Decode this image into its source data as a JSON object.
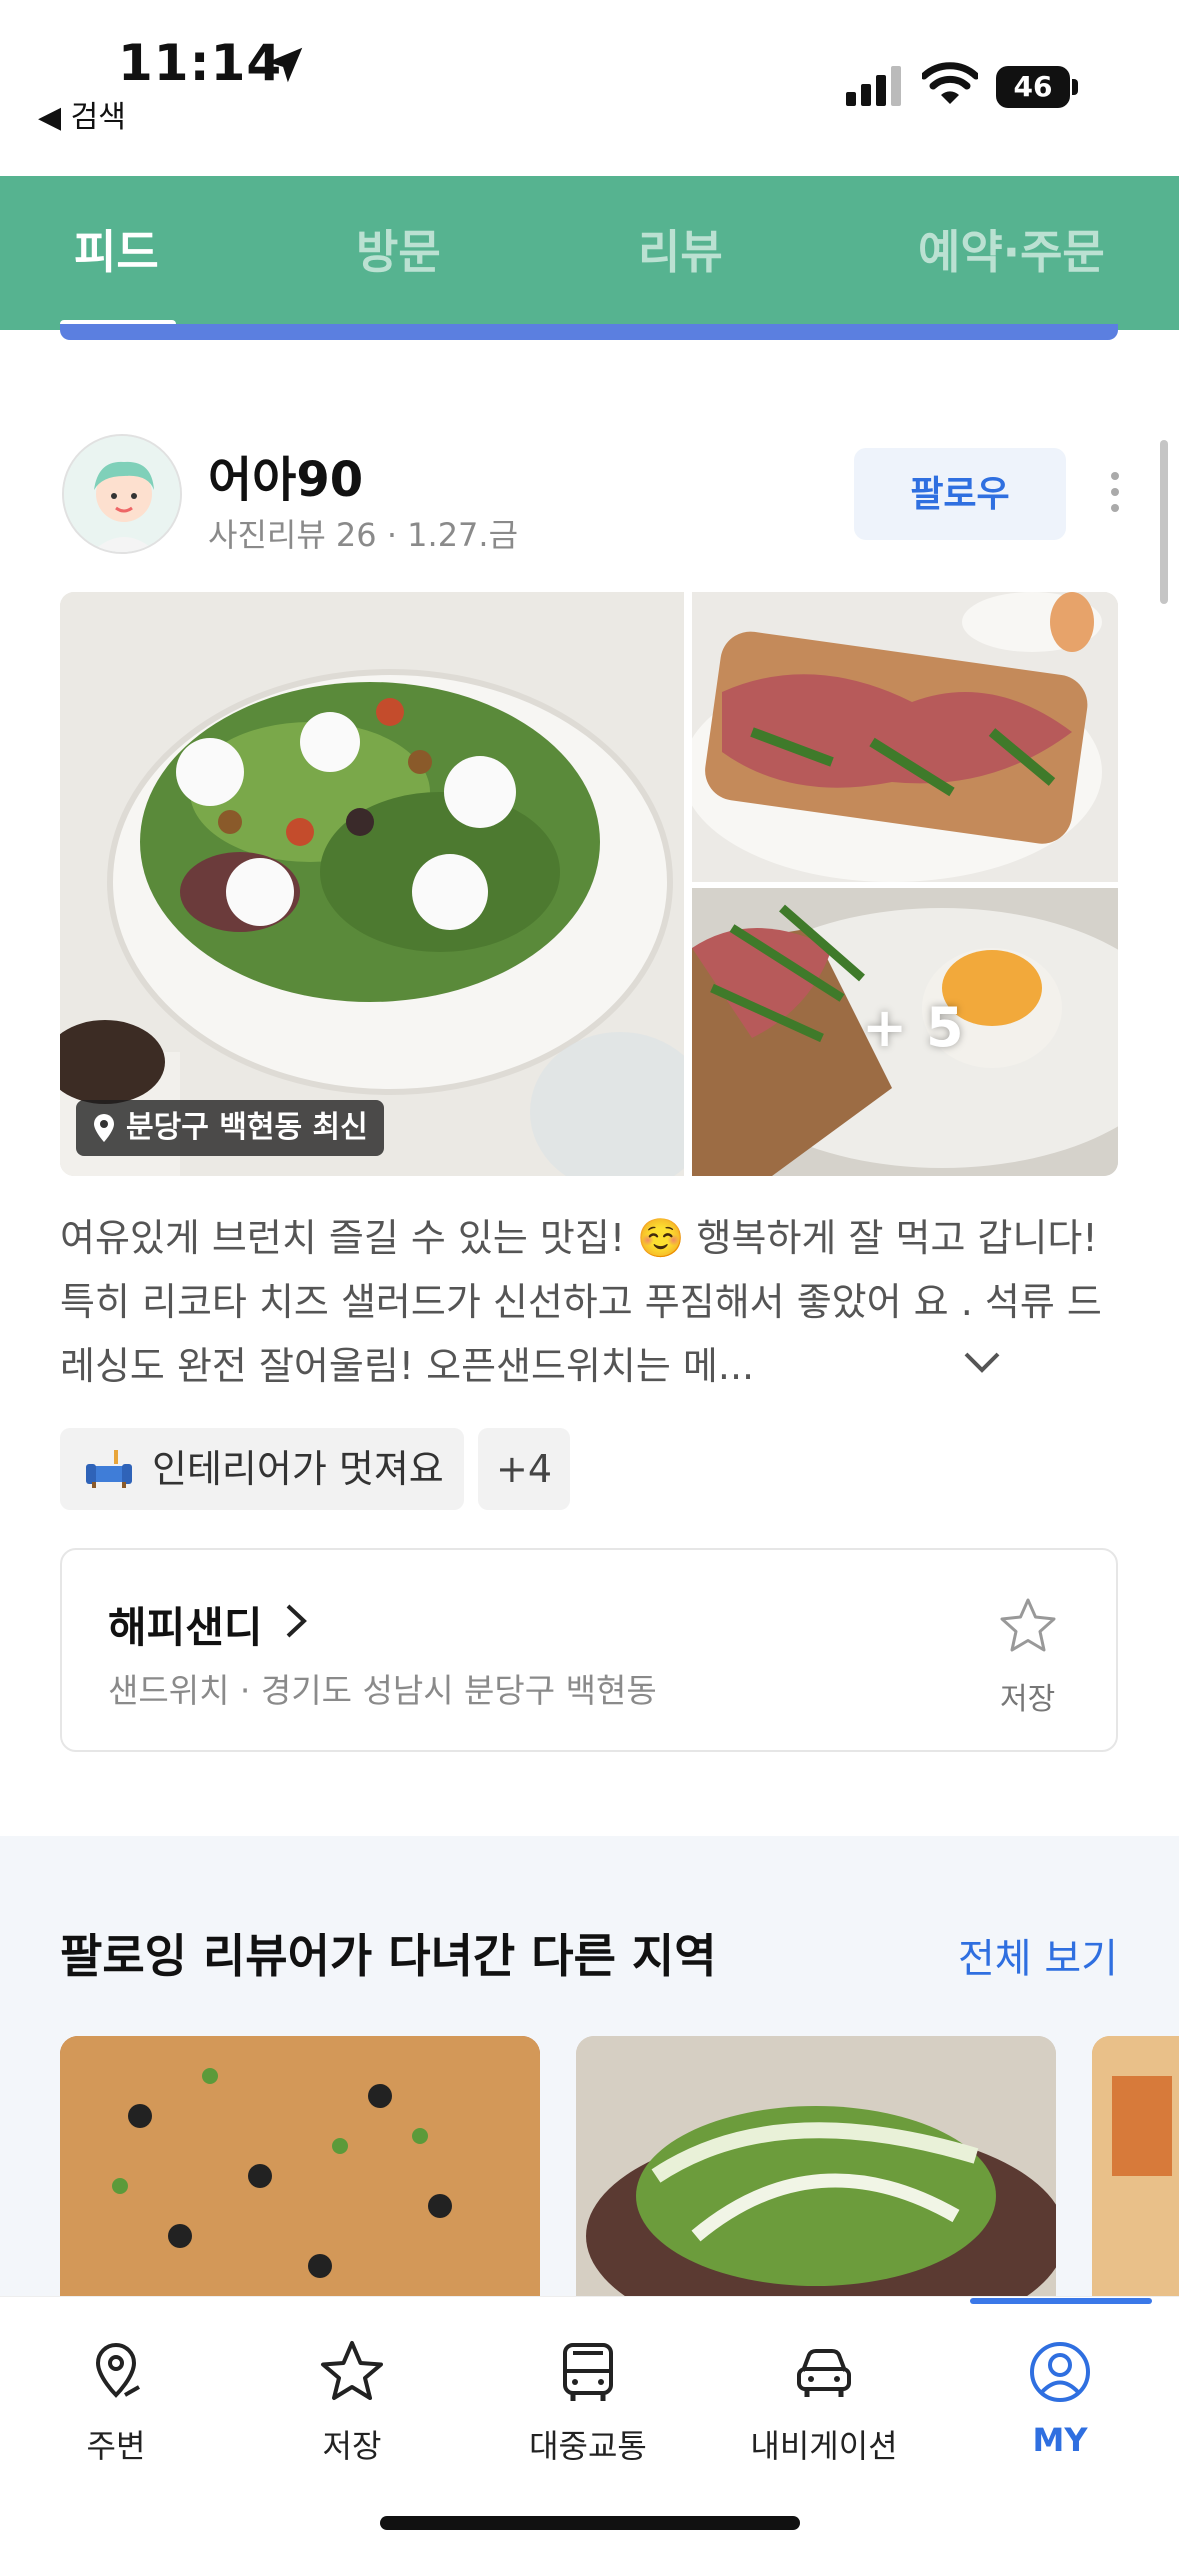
{
  "status_bar": {
    "time": "11:14",
    "back_label": "◀ 검색",
    "battery": "46"
  },
  "tabs": [
    {
      "label": "피드",
      "active": true
    },
    {
      "label": "방문",
      "active": false
    },
    {
      "label": "리뷰",
      "active": false
    },
    {
      "label": "예약·주문",
      "active": false
    }
  ],
  "post": {
    "username": "어아90",
    "user_info": "사진리뷰 26 · 1.27.금",
    "follow_label": "팔로우",
    "location_badge": "분당구 백현동 최신",
    "extra_photos": "+ 5",
    "review_text": "여유있게 브런치 즐길 수 있는 맛집! ☺️ 행복하게 잘 먹고 갑니다! 특히 리코타 치즈 샐러드가 신선하고 푸짐해서 좋았어 요 . 석류 드레싱도 완전 잘어울림! 오픈샌드위치는 메...",
    "tag_label": "인테리어가 멋져요",
    "tag_more": "+4"
  },
  "place": {
    "name": "해피샌디",
    "subtitle": "샌드위치 · 경기도 성남시 분당구 백현동",
    "save_label": "저장"
  },
  "section": {
    "title": "팔로잉 리뷰어가 다녀간 다른 지역",
    "view_all": "전체 보기"
  },
  "bottom_nav": [
    {
      "label": "주변",
      "icon": "location-pin-icon"
    },
    {
      "label": "저장",
      "icon": "star-icon"
    },
    {
      "label": "대중교통",
      "icon": "bus-icon"
    },
    {
      "label": "내비게이션",
      "icon": "car-icon"
    },
    {
      "label": "MY",
      "icon": "profile-icon",
      "active": true
    }
  ],
  "colors": {
    "tab_bar_bg": "#56b390",
    "accent_blue": "#2f6fe0"
  }
}
